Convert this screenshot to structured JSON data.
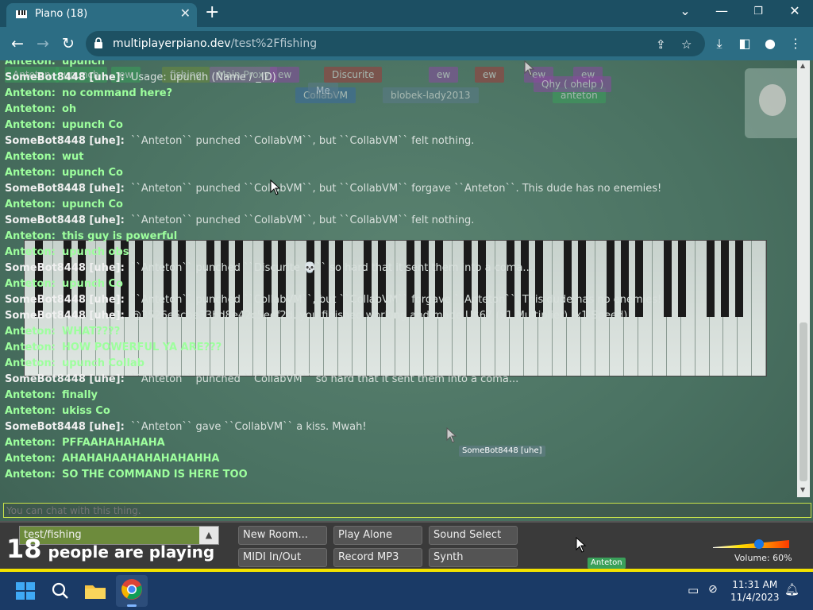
{
  "browser": {
    "tab_title": "Piano (18)",
    "url_host": "multiplayerpiano.dev",
    "url_path": "/test%2Ffishing"
  },
  "background_tags": [
    {
      "label": "Anteton",
      "color": "#3aa05a"
    },
    {
      "label": "upunch",
      "color": "#3aa05a"
    },
    {
      "label": "ew",
      "color": "#3aa05a"
    },
    {
      "label": "fishing",
      "color": "#6d8b3c"
    },
    {
      "label": "Main Proxy",
      "color": "#8a6a9a"
    },
    {
      "label": "ew",
      "color": "#8a4aa0"
    },
    {
      "label": "Discurite",
      "color": "#a03a3a"
    },
    {
      "label": "ew",
      "color": "#8a4aa0"
    },
    {
      "label": "ew",
      "color": "#a03a3a"
    },
    {
      "label": "ew",
      "color": "#8a4aa0"
    },
    {
      "label": "ew",
      "color": "#8a4aa0"
    },
    {
      "label": "CollabVM",
      "color": "#3a6aa0"
    },
    {
      "label": "blobek-lady2013",
      "color": "#5a7a8a"
    },
    {
      "label": "anteton",
      "color": "#3aa05a"
    },
    {
      "label": "Qhy ( ohelp )",
      "color": "#8a4aa0"
    },
    {
      "label": "Me",
      "color": "#5a7a8a"
    }
  ],
  "chat": [
    {
      "who": "Anteton:",
      "text": "upunch",
      "kind": "anteton"
    },
    {
      "who": "SomeBot8448 [uhe]:",
      "text": "Usage: upunch (Name / _ID)",
      "kind": "bot"
    },
    {
      "who": "Anteton:",
      "text": "no command here?",
      "kind": "anteton"
    },
    {
      "who": "Anteton:",
      "text": "oh",
      "kind": "anteton"
    },
    {
      "who": "Anteton:",
      "text": "upunch Co",
      "kind": "anteton"
    },
    {
      "who": "SomeBot8448 [uhe]:",
      "text": "``Anteton`` punched ``CollabVM``, but ``CollabVM`` felt nothing.",
      "kind": "bot"
    },
    {
      "who": "Anteton:",
      "text": "wut",
      "kind": "anteton"
    },
    {
      "who": "Anteton:",
      "text": "upunch Co",
      "kind": "anteton"
    },
    {
      "who": "SomeBot8448 [uhe]:",
      "text": "``Anteton`` punched ``CollabVM``, but ``CollabVM`` forgave ``Anteton``. This dude has no enemies!",
      "kind": "bot"
    },
    {
      "who": "Anteton:",
      "text": "upunch Co",
      "kind": "anteton"
    },
    {
      "who": "SomeBot8448 [uhe]:",
      "text": "``Anteton`` punched ``CollabVM``, but ``CollabVM`` felt nothing.",
      "kind": "bot"
    },
    {
      "who": "Anteton:",
      "text": "this guy is powerful",
      "kind": "anteton"
    },
    {
      "who": "Anteton:",
      "text": "upunch obs",
      "kind": "anteton"
    },
    {
      "who": "SomeBot8448 [uhe]:",
      "text": "``Anteton`` punched ``Discurite 💀`` so hard that it sent them into a coma...",
      "kind": "bot"
    },
    {
      "who": "Anteton:",
      "text": "upunch Co",
      "kind": "anteton"
    },
    {
      "who": "SomeBot8448 [uhe]:",
      "text": "``Anteton`` punched ``CollabVM``, but ``CollabVM`` forgave ``Anteton``. This dude has no enemies!",
      "kind": "bot"
    },
    {
      "who": "SomeBot8448 [uhe]:",
      "text": "@3526e5cbe33bd8e42c5eef2d, you finished working and made U$67 (x1 Multiplier) (x1 Speed)",
      "kind": "bot"
    },
    {
      "who": "Anteton:",
      "text": "WHAT????",
      "kind": "anteton"
    },
    {
      "who": "Anteton:",
      "text": "HOW POWERFUL YA ARE???",
      "kind": "anteton"
    },
    {
      "who": "Anteton:",
      "text": "upunch Collab",
      "kind": "anteton"
    },
    {
      "who": "SomeBot8448 [uhe]:",
      "text": "``Anteton`` punched ``CollabVM`` so hard that it sent them into a coma...",
      "kind": "bot"
    },
    {
      "who": "Anteton:",
      "text": "finally",
      "kind": "anteton"
    },
    {
      "who": "Anteton:",
      "text": "ukiss Co",
      "kind": "anteton"
    },
    {
      "who": "SomeBot8448 [uhe]:",
      "text": "``Anteton`` gave ``CollabVM`` a kiss. Mwah!",
      "kind": "bot"
    },
    {
      "who": "Anteton:",
      "text": "PFFAAHAHAHAHA",
      "kind": "anteton"
    },
    {
      "who": "Anteton:",
      "text": "AHAHAHAAHAHAHAHAHHA",
      "kind": "anteton"
    },
    {
      "who": "Anteton:",
      "text": "SO THE COMMAND IS HERE TOO",
      "kind": "anteton"
    }
  ],
  "chat_input": {
    "placeholder": "You can chat with this thing."
  },
  "cursor_tags": {
    "somebot": "SomeBot8448 [uhe]",
    "anteton": "Anteton"
  },
  "bottom": {
    "room": "test/fishing",
    "count": "18",
    "count_text": "people are playing",
    "buttons": {
      "new_room": "New Room...",
      "play_alone": "Play Alone",
      "sound_select": "Sound Select",
      "midi": "MIDI In/Out",
      "record": "Record MP3",
      "synth": "Synth"
    },
    "volume_label": "Volume: 60%",
    "volume": 0.6
  },
  "taskbar": {
    "time": "11:31 AM",
    "date": "11/4/2023"
  }
}
